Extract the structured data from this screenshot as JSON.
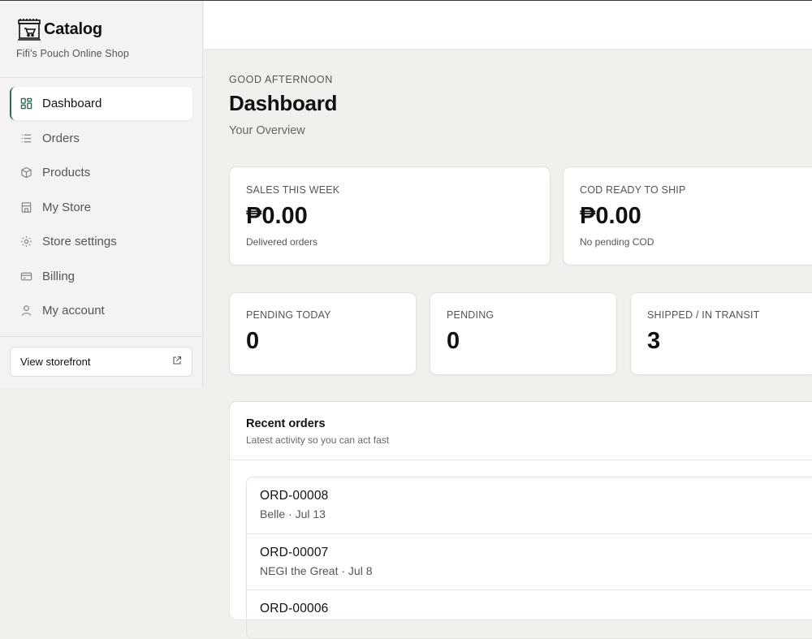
{
  "sidebar": {
    "brand_title": "Catalog",
    "brand_subtitle": "Fifi's Pouch Online Shop",
    "items": [
      {
        "label": "Dashboard",
        "icon": "grid-icon",
        "active": true
      },
      {
        "label": "Orders",
        "icon": "list-icon"
      },
      {
        "label": "Products",
        "icon": "box-icon"
      },
      {
        "label": "My Store",
        "icon": "store-icon"
      },
      {
        "label": "Store settings",
        "icon": "gear-icon"
      },
      {
        "label": "Billing",
        "icon": "credit-card-icon"
      },
      {
        "label": "My account",
        "icon": "user-icon"
      }
    ],
    "storefront_label": "View storefront"
  },
  "main": {
    "greeting": "GOOD AFTERNOON",
    "title": "Dashboard",
    "subtitle": "Your Overview",
    "stats_top": [
      {
        "label": "SALES THIS WEEK",
        "value": "₱0.00",
        "note": "Delivered orders"
      },
      {
        "label": "COD READY TO SHIP",
        "value": "₱0.00",
        "note": "No pending COD"
      }
    ],
    "stats_bottom": [
      {
        "label": "PENDING TODAY",
        "value": "0"
      },
      {
        "label": "PENDING",
        "value": "0"
      },
      {
        "label": "SHIPPED / IN TRANSIT",
        "value": "3"
      }
    ],
    "recent": {
      "title": "Recent orders",
      "subtitle": "Latest activity so you can act fast",
      "orders": [
        {
          "id": "ORD-00008",
          "meta": "Belle · Jul 13"
        },
        {
          "id": "ORD-00007",
          "meta": "NEGI the Great · Jul 8"
        },
        {
          "id": "ORD-00006",
          "meta": ""
        }
      ]
    }
  },
  "colors": {
    "accent": "#2d6b4e",
    "background": "#f1f0ec"
  }
}
